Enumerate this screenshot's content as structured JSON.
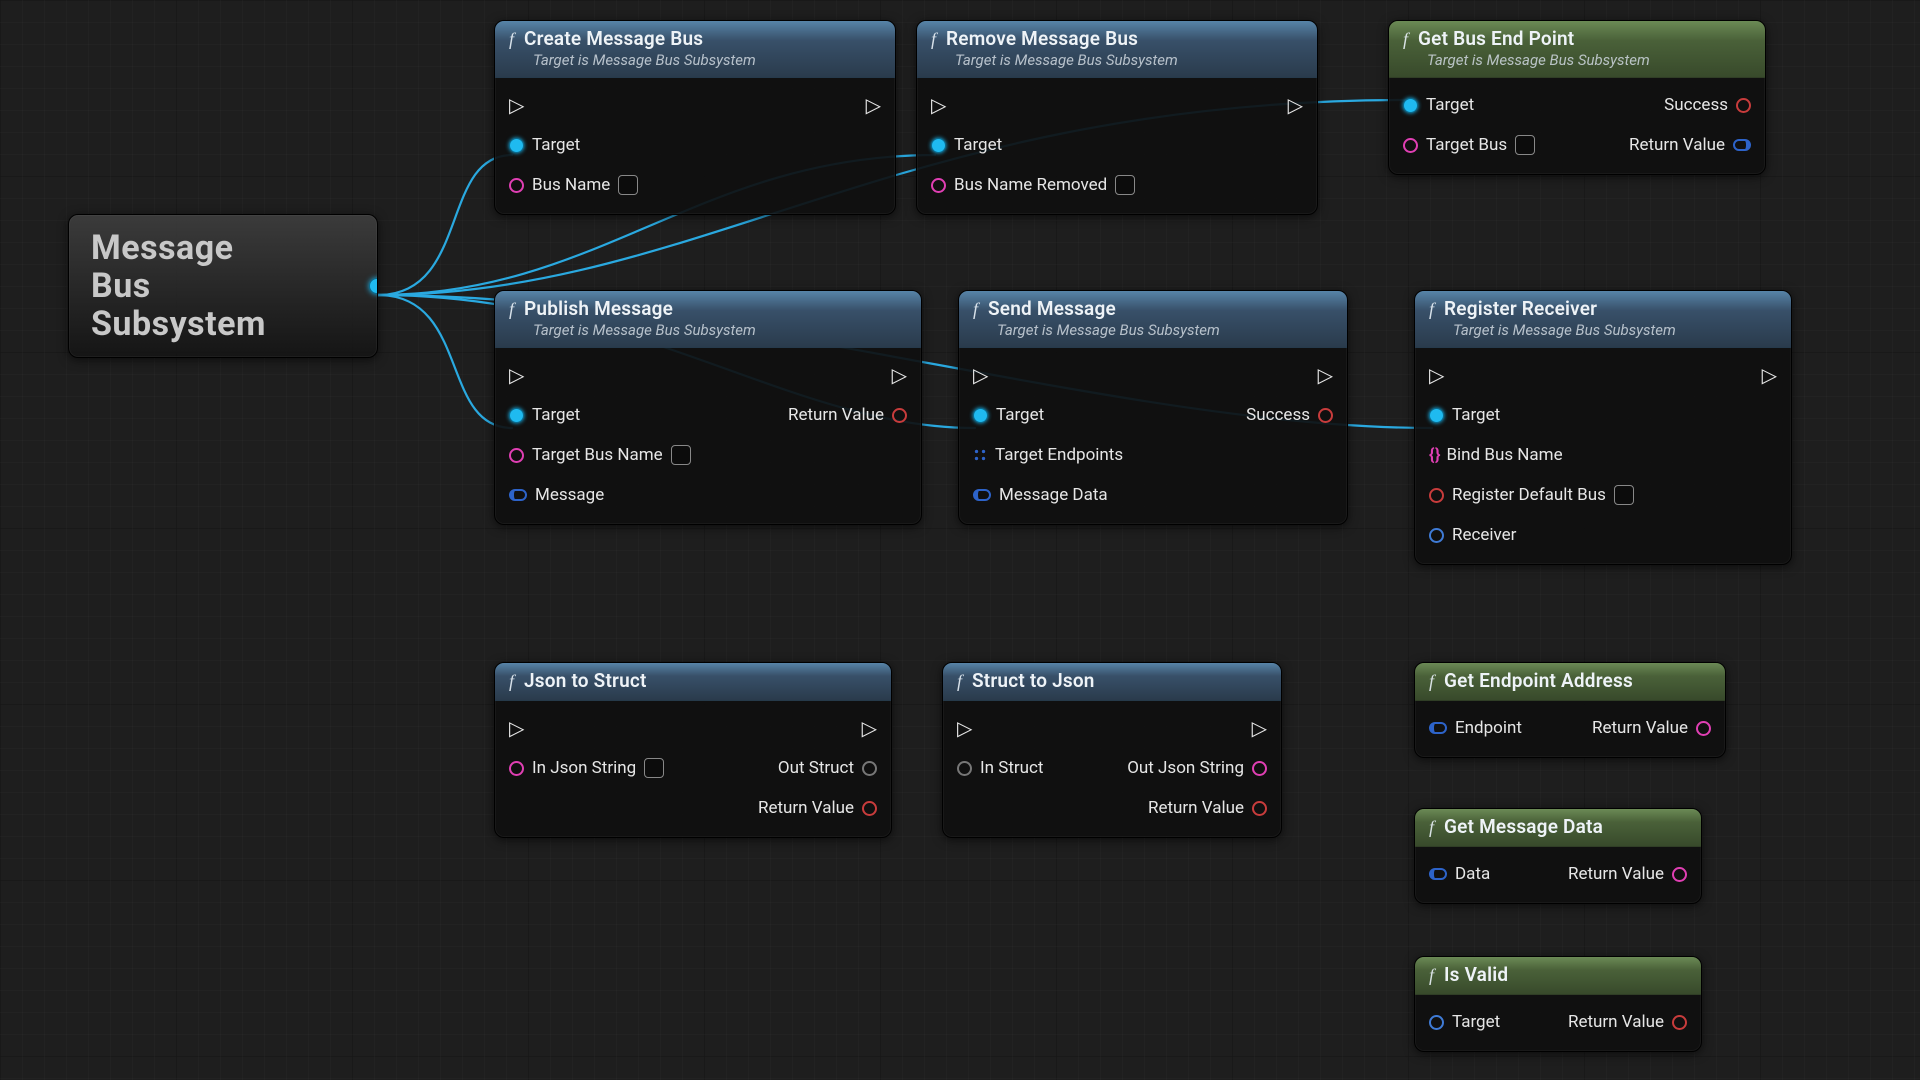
{
  "source_node": {
    "title_l1": "Message",
    "title_l2": "Bus",
    "title_l3": "Subsystem"
  },
  "subtitle_common": "Target is Message Bus Subsystem",
  "nodes": {
    "create_bus": {
      "title": "Create Message Bus",
      "inputs": {
        "target": "Target",
        "bus_name": "Bus Name"
      }
    },
    "remove_bus": {
      "title": "Remove Message Bus",
      "inputs": {
        "target": "Target",
        "bus_name_removed": "Bus Name Removed"
      }
    },
    "get_endpoint": {
      "title": "Get Bus End Point",
      "inputs": {
        "target": "Target",
        "target_bus": "Target Bus"
      },
      "outputs": {
        "success": "Success",
        "return_value": "Return Value"
      }
    },
    "publish": {
      "title": "Publish Message",
      "inputs": {
        "target": "Target",
        "target_bus_name": "Target Bus Name",
        "message": "Message"
      },
      "outputs": {
        "return_value": "Return Value"
      }
    },
    "send": {
      "title": "Send Message",
      "inputs": {
        "target": "Target",
        "target_endpoints": "Target Endpoints",
        "message_data": "Message Data"
      },
      "outputs": {
        "success": "Success"
      }
    },
    "register_receiver": {
      "title": "Register Receiver",
      "inputs": {
        "target": "Target",
        "bind_bus_name": "Bind Bus Name",
        "register_default_bus": "Register Default Bus",
        "receiver": "Receiver"
      }
    },
    "json_to_struct": {
      "title": "Json to Struct",
      "inputs": {
        "in_json": "In Json String"
      },
      "outputs": {
        "out_struct": "Out Struct",
        "return_value": "Return Value"
      }
    },
    "struct_to_json": {
      "title": "Struct to Json",
      "inputs": {
        "in_struct": "In Struct"
      },
      "outputs": {
        "out_json": "Out Json String",
        "return_value": "Return Value"
      }
    },
    "get_endpoint_addr": {
      "title": "Get Endpoint Address",
      "inputs": {
        "endpoint": "Endpoint"
      },
      "outputs": {
        "return_value": "Return Value"
      }
    },
    "get_message_data": {
      "title": "Get Message Data",
      "inputs": {
        "data": "Data"
      },
      "outputs": {
        "return_value": "Return Value"
      }
    },
    "is_valid": {
      "title": "Is Valid",
      "inputs": {
        "target": "Target"
      },
      "outputs": {
        "return_value": "Return Value"
      }
    }
  },
  "wires": [
    {
      "from": "source",
      "to": "create_bus.target"
    },
    {
      "from": "source",
      "to": "remove_bus.target"
    },
    {
      "from": "source",
      "to": "publish.target"
    },
    {
      "from": "source",
      "to": "send.target"
    },
    {
      "from": "source",
      "to": "register_receiver.target"
    },
    {
      "from": "source",
      "to": "get_endpoint.target"
    }
  ]
}
